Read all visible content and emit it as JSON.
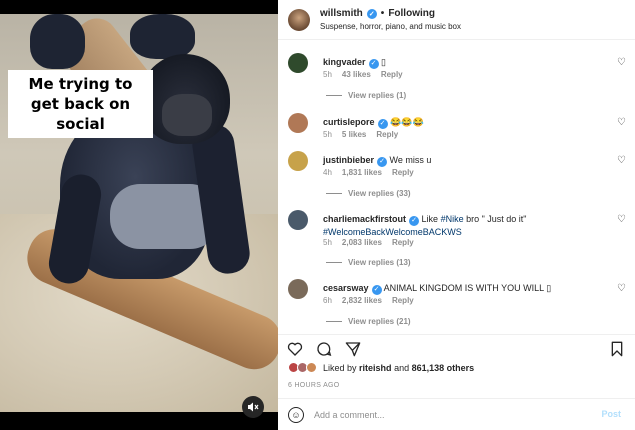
{
  "post": {
    "caption_overlay": "Me trying to get back on social",
    "mute_icon": "speaker-muted-icon"
  },
  "header": {
    "username": "willsmith",
    "separator": "•",
    "follow_status": "Following",
    "bio": "Suspense, horror, piano, and music box"
  },
  "comments": [
    {
      "user": "kingvader",
      "verified": true,
      "text": "▯",
      "time": "5h",
      "likes": "43 likes",
      "reply": "Reply",
      "replies": "View replies (1)",
      "avatar_color": "#2f4a2c"
    },
    {
      "user": "curtislepore",
      "verified": true,
      "text": "😂😂😂",
      "time": "5h",
      "likes": "5 likes",
      "reply": "Reply",
      "replies": "",
      "avatar_color": "#b07856"
    },
    {
      "user": "justinbieber",
      "verified": true,
      "text": "We miss u",
      "time": "4h",
      "likes": "1,831 likes",
      "reply": "Reply",
      "replies": "View replies (33)",
      "avatar_color": "#c7a24a"
    },
    {
      "user": "charliemackfirstout",
      "verified": true,
      "text_prefix": "Like ",
      "hashtag1": "#Nike",
      "text_mid": " bro \" Just do it\" ",
      "hashtag2": "#WelcomeBackWelcomeBACKWS",
      "time": "5h",
      "likes": "2,083 likes",
      "reply": "Reply",
      "replies": "View replies (13)",
      "avatar_color": "#4a5a6a"
    },
    {
      "user": "cesarsway",
      "verified": true,
      "text": "ANIMAL KINGDOM IS WITH YOU WILL ▯",
      "time": "6h",
      "likes": "2,832 likes",
      "reply": "Reply",
      "replies": "View replies (21)",
      "avatar_color": "#7a6a5a"
    }
  ],
  "likes_summary": {
    "prefix": "Liked by",
    "user": "riteishd",
    "joiner": "and",
    "count": "861,138 others"
  },
  "timestamp": "6 HOURS AGO",
  "add_comment": {
    "placeholder": "Add a comment...",
    "post_label": "Post"
  },
  "icons": {
    "like": "heart-icon",
    "comment": "comment-icon",
    "share": "paper-plane-icon",
    "save": "bookmark-icon",
    "emoji": "emoji-icon"
  },
  "colors": {
    "verified": "#3897f0",
    "hashtag": "#00376b",
    "post_disabled": "#b2dffc",
    "muted_text": "#8e8e8e"
  }
}
